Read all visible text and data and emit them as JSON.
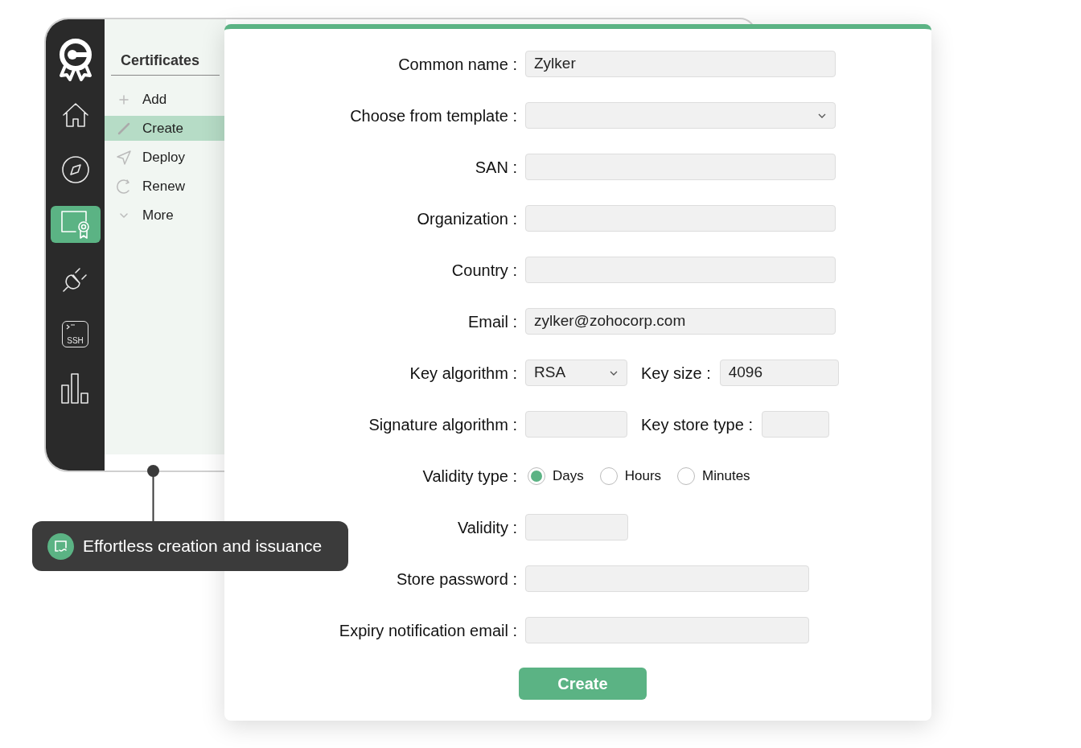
{
  "rail": [
    {
      "kind": "logo",
      "selected": false
    },
    {
      "kind": "home",
      "selected": false
    },
    {
      "kind": "compass",
      "selected": false
    },
    {
      "kind": "certificate",
      "selected": true
    },
    {
      "kind": "plug",
      "selected": false
    },
    {
      "kind": "ssh",
      "text": "SSH",
      "selected": false
    },
    {
      "kind": "chart",
      "selected": false
    }
  ],
  "submenu": {
    "title": "Certificates",
    "items": [
      {
        "label": "Add",
        "selected": false
      },
      {
        "label": "Create",
        "selected": true
      },
      {
        "label": "Deploy",
        "selected": false
      },
      {
        "label": "Renew",
        "selected": false
      },
      {
        "label": "More",
        "selected": false
      }
    ]
  },
  "form": {
    "rows": [
      {
        "label": "Common name :",
        "kind": "text",
        "value": "Zylker"
      },
      {
        "label": "Choose from template :",
        "kind": "select"
      },
      {
        "label": "SAN :",
        "kind": "text"
      },
      {
        "label": "Organization :",
        "kind": "text"
      },
      {
        "label": "Country :",
        "kind": "text"
      },
      {
        "label": "Email :",
        "kind": "text",
        "value": "zylker@zohocorp.com"
      },
      {
        "label": "Key algorithm :",
        "kind": "pair",
        "main": {
          "kind": "select",
          "value": "RSA"
        },
        "second": {
          "label": "Key size :",
          "value": "4096"
        }
      },
      {
        "label": "Signature algorithm :",
        "kind": "pair",
        "main": {
          "kind": "text"
        },
        "second": {
          "label": "Key store type :"
        }
      },
      {
        "label": "Validity type :",
        "kind": "radio",
        "options": [
          {
            "label": "Days",
            "selected": true
          },
          {
            "label": "Hours",
            "selected": false
          },
          {
            "label": "Minutes",
            "selected": false
          }
        ]
      },
      {
        "label": "Validity :",
        "kind": "short"
      },
      {
        "label": "Store password :",
        "kind": "medium"
      },
      {
        "label": "Expiry notification email :",
        "kind": "medium"
      }
    ],
    "button": "Create"
  },
  "callout": {
    "text": "Effortless creation and issuance"
  }
}
